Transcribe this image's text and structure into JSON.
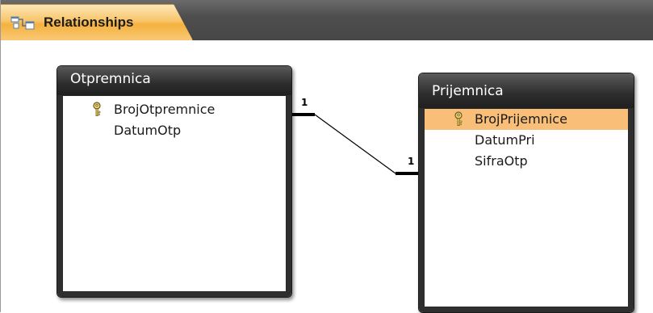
{
  "tab": {
    "label": "Relationships",
    "icon": "relationships-icon"
  },
  "tables": [
    {
      "name": "Otpremnica",
      "fields": [
        {
          "name": "BrojOtpremnice",
          "primary_key": true,
          "selected": false
        },
        {
          "name": "DatumOtp",
          "primary_key": false,
          "selected": false
        }
      ]
    },
    {
      "name": "Prijemnica",
      "fields": [
        {
          "name": "BrojPrijemnice",
          "primary_key": true,
          "selected": true
        },
        {
          "name": "DatumPri",
          "primary_key": false,
          "selected": false
        },
        {
          "name": "SifraOtp",
          "primary_key": false,
          "selected": false
        }
      ]
    }
  ],
  "relationship": {
    "from_table": "Otpremnica",
    "to_table": "Prijemnica",
    "from_cardinality": "1",
    "to_cardinality": "1"
  },
  "colors": {
    "tab_accent": "#f5b13e",
    "selected_row": "#f9bf79",
    "title_bar": "#2d2d2d"
  }
}
